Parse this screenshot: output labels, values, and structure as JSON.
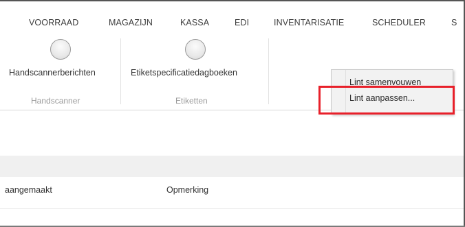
{
  "menu": {
    "items": [
      "VOORRAAD",
      "MAGAZIJN",
      "KASSA",
      "EDI",
      "INVENTARISATIE",
      "SCHEDULER",
      "S"
    ]
  },
  "ribbon": {
    "buttons": [
      {
        "label": "Handscannerberichten",
        "icon": "circle-button-icon"
      },
      {
        "label": "Etiketspecificatiedagboeken",
        "icon": "circle-button-icon"
      }
    ],
    "groups": [
      "Handscanner",
      "Etiketten"
    ]
  },
  "context_menu": {
    "items": [
      "Lint samenvouwen",
      "Lint aanpassen..."
    ],
    "highlighted_item": "Lint aanpassen...",
    "highlight_color": "#e8202a"
  },
  "table": {
    "columns": [
      "aangemaakt",
      "Opmerking"
    ]
  }
}
